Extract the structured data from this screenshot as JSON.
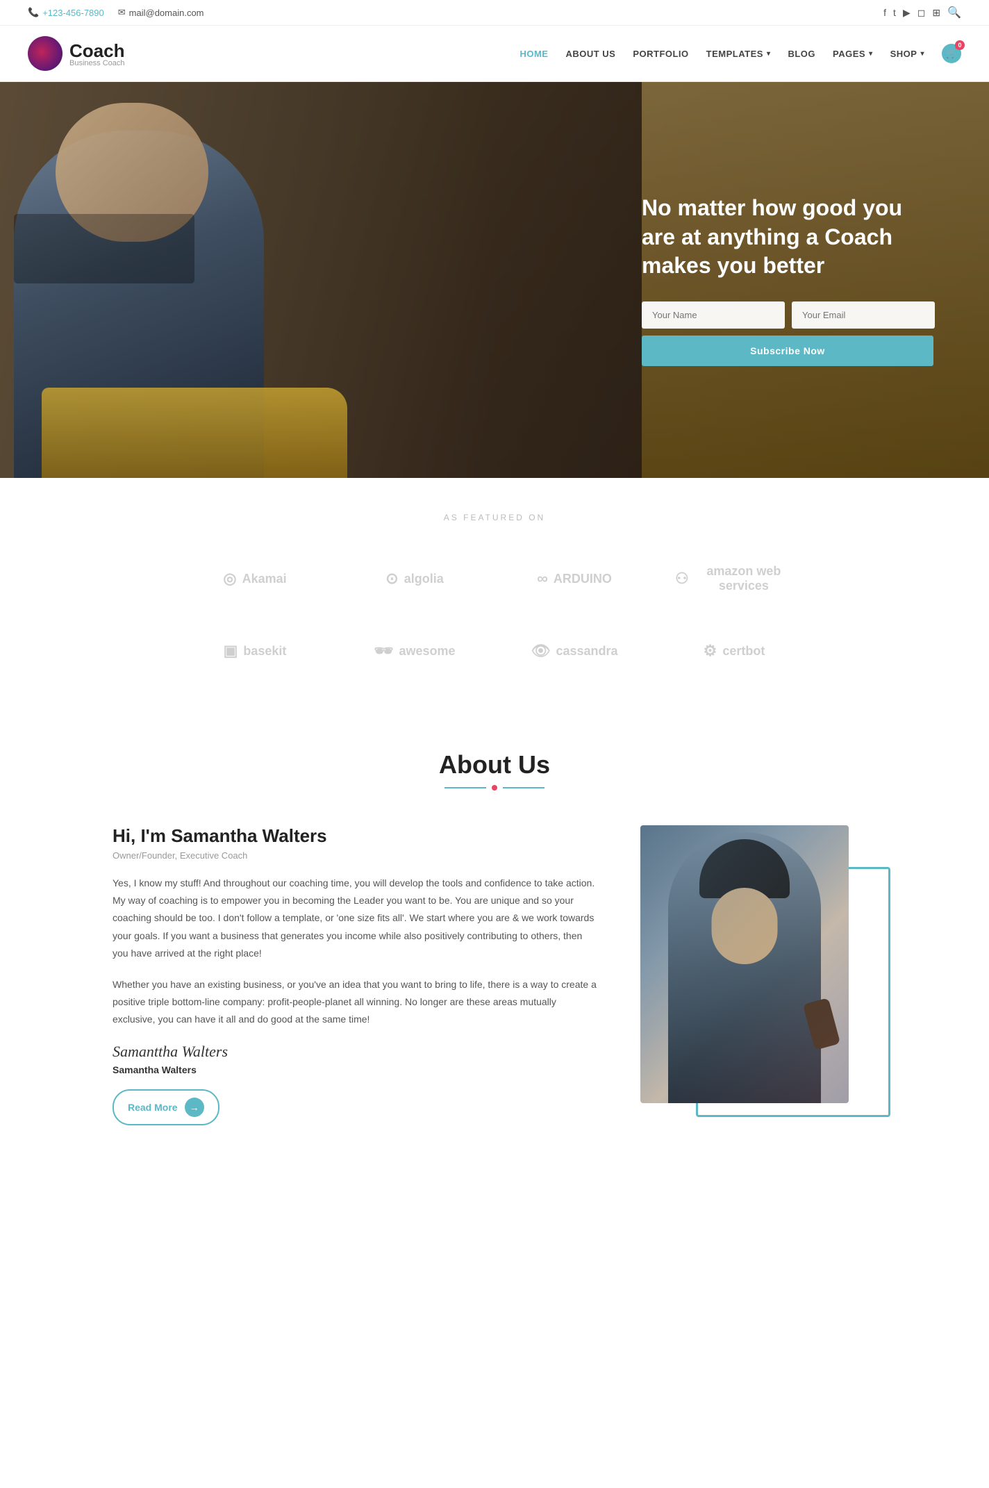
{
  "topbar": {
    "phone": "+123-456-7890",
    "email": "mail@domain.com",
    "socials": [
      "facebook",
      "twitter",
      "youtube",
      "instagram",
      "vimeo"
    ]
  },
  "header": {
    "logo_name": "Coach",
    "logo_tagline": "Business Coach",
    "nav": [
      {
        "label": "HOME",
        "active": true
      },
      {
        "label": "ABOUT US",
        "active": false
      },
      {
        "label": "PORTFOLIO",
        "active": false
      },
      {
        "label": "TEMPLATES",
        "active": false,
        "dropdown": true
      },
      {
        "label": "BLOG",
        "active": false
      },
      {
        "label": "PAGES",
        "active": false,
        "dropdown": true
      },
      {
        "label": "SHOP",
        "active": false,
        "dropdown": true
      }
    ],
    "cart_count": "0"
  },
  "hero": {
    "title": "No matter how good you are at anything a Coach makes you better",
    "name_placeholder": "Your Name",
    "email_placeholder": "Your Email",
    "subscribe_label": "Subscribe Now"
  },
  "featured": {
    "label": "AS FEATURED ON",
    "logos": [
      {
        "name": "Akamai",
        "icon": "◎"
      },
      {
        "name": "algolia",
        "icon": "⊙"
      },
      {
        "name": "ARDUINO",
        "icon": "∞"
      },
      {
        "name": "amazon web services",
        "icon": "⚇"
      },
      {
        "name": "basekit",
        "icon": "▣"
      },
      {
        "name": "awesome",
        "icon": "👓"
      },
      {
        "name": "cassandra",
        "icon": "👁"
      },
      {
        "name": "certbot",
        "icon": "⚙"
      }
    ]
  },
  "about": {
    "section_title": "About Us",
    "person_name": "Hi, I'm Samantha Walters",
    "person_role": "Owner/Founder, Executive Coach",
    "para1": "Yes, I know my stuff! And throughout our coaching time, you will develop the tools and confidence to take action. My way of coaching is to empower you in becoming the Leader you want to be. You are unique and so your coaching should be too. I don't follow a template, or 'one size fits all'. We start where you are & we work towards your goals. If you want a business that generates you income while also positively contributing to others, then you have arrived at the right place!",
    "para2": "Whether you have an existing business, or you've an idea that you want to bring to life, there is a way to create a positive triple bottom-line company: profit-people-planet all winning. No longer are these areas mutually exclusive, you can have it all and do good at the same time!",
    "signature": "Samanttha Walters",
    "sig_name": "Samantha Walters",
    "read_more": "Read More"
  }
}
